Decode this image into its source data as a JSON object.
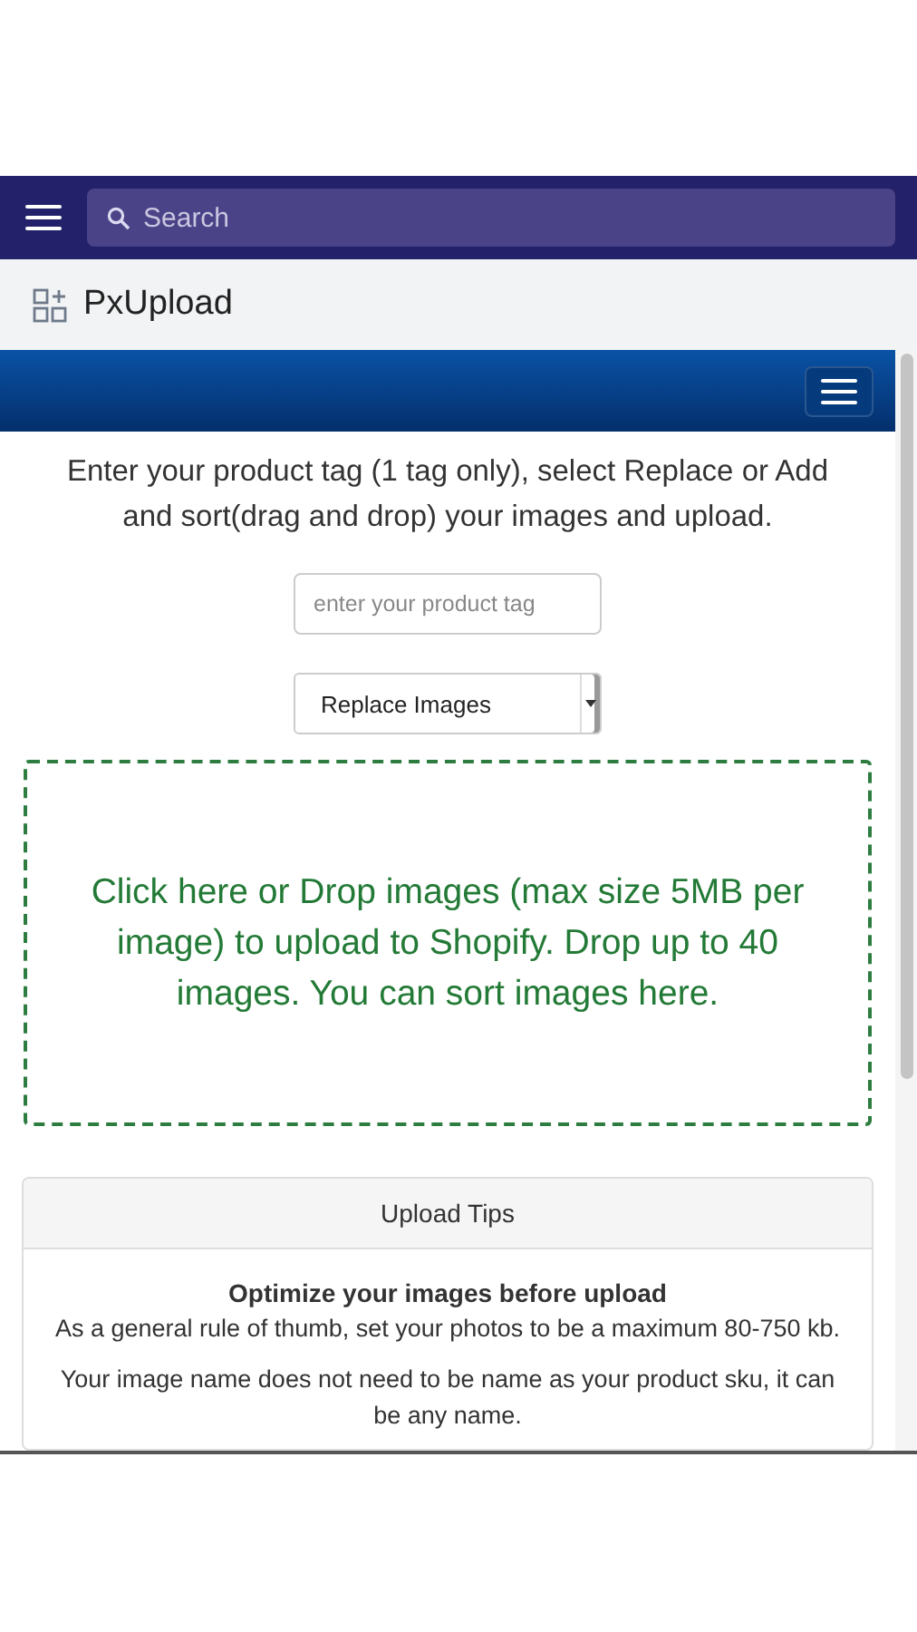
{
  "top_bar": {
    "search": {
      "placeholder": "Search"
    }
  },
  "app_header": {
    "title": "PxUpload"
  },
  "instructions": "Enter your product tag (1 tag only), select Replace or Add and sort(drag and drop) your images and upload.",
  "tag_field": {
    "placeholder": "enter your product tag"
  },
  "mode_select": {
    "value": "Replace Images"
  },
  "drop_zone": {
    "text": "Click here or Drop images (max size 5MB per image) to upload to Shopify. Drop up to 40 images. You can sort images here."
  },
  "tips": {
    "title": "Upload Tips",
    "heading": "Optimize your images before upload",
    "paragraphs": [
      "As a general rule of thumb, set your photos to be a maximum 80-750 kb.",
      "Your image name does not need to be name as your product sku, it can be any name."
    ]
  }
}
